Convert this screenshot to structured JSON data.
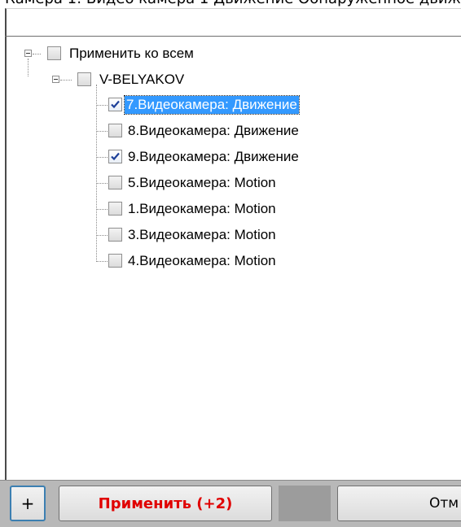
{
  "top_cut_text": "Камера 1: Видео камера 1 Движение Обнаруженное движ...",
  "tree": {
    "root": {
      "label": "Применить ко всем",
      "checked": false
    },
    "server": {
      "label": "V-BELYAKOV",
      "checked": false
    },
    "items": [
      {
        "label": "7.Видеокамера: Движение",
        "checked": true,
        "selected": true
      },
      {
        "label": "8.Видеокамера: Движение",
        "checked": false,
        "selected": false
      },
      {
        "label": "9.Видеокамера: Движение",
        "checked": true,
        "selected": false
      },
      {
        "label": "5.Видеокамера: Motion",
        "checked": false,
        "selected": false
      },
      {
        "label": "1.Видеокамера: Motion",
        "checked": false,
        "selected": false
      },
      {
        "label": "3.Видеокамера: Motion",
        "checked": false,
        "selected": false
      },
      {
        "label": "4.Видеокамера: Motion",
        "checked": false,
        "selected": false
      }
    ]
  },
  "buttons": {
    "plus": "+",
    "apply": "Применить (+2)",
    "cancel": "Отм"
  }
}
